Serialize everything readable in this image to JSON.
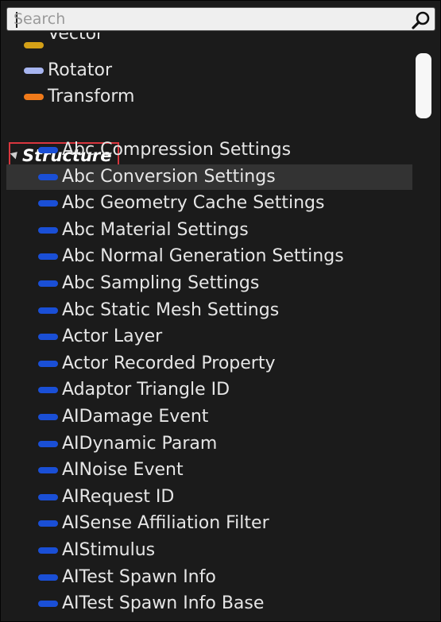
{
  "search": {
    "placeholder": "Search",
    "value": ""
  },
  "top_items": [
    {
      "label": "Vector",
      "color": "#d4a017"
    },
    {
      "label": "Rotator",
      "color": "#a7b5f0"
    },
    {
      "label": "Transform",
      "color": "#f07a1a"
    }
  ],
  "category": {
    "label": "Structure",
    "expanded": true
  },
  "struct_items": [
    {
      "label": "Abc Compression Settings",
      "selected": false
    },
    {
      "label": "Abc Conversion Settings",
      "selected": true
    },
    {
      "label": "Abc Geometry Cache Settings",
      "selected": false
    },
    {
      "label": "Abc Material Settings",
      "selected": false
    },
    {
      "label": "Abc Normal Generation Settings",
      "selected": false
    },
    {
      "label": "Abc Sampling Settings",
      "selected": false
    },
    {
      "label": "Abc Static Mesh Settings",
      "selected": false
    },
    {
      "label": "Actor Layer",
      "selected": false
    },
    {
      "label": "Actor Recorded Property",
      "selected": false
    },
    {
      "label": "Adaptor Triangle ID",
      "selected": false
    },
    {
      "label": "AIDamage Event",
      "selected": false
    },
    {
      "label": "AIDynamic Param",
      "selected": false
    },
    {
      "label": "AINoise Event",
      "selected": false
    },
    {
      "label": "AIRequest ID",
      "selected": false
    },
    {
      "label": "AISense Affiliation Filter",
      "selected": false
    },
    {
      "label": "AIStimulus",
      "selected": false
    },
    {
      "label": "AITest Spawn Info",
      "selected": false
    },
    {
      "label": "AITest Spawn Info Base",
      "selected": false
    }
  ],
  "colors": {
    "struct_pill": "#1a4fd6",
    "highlight_box": "#d9363e",
    "selected_row": "#333333"
  }
}
